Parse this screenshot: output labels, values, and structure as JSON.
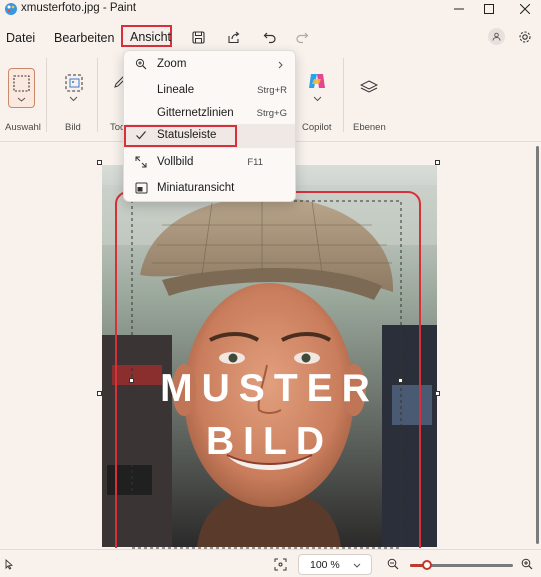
{
  "window": {
    "title": "xmusterfoto.jpg - Paint"
  },
  "menubar": {
    "datei": "Datei",
    "bearbeiten": "Bearbeiten",
    "ansicht": "Ansicht"
  },
  "ribbon": {
    "groups": {
      "auswahl": "Auswahl",
      "bild": "Bild",
      "tools": "Too",
      "copilot": "Copilot",
      "ebenen": "Ebenen"
    }
  },
  "view_menu": {
    "zoom": "Zoom",
    "lineale": "Lineale",
    "lineale_shortcut": "Strg+R",
    "gitternetzlinien": "Gitternetzlinien",
    "gitternetzlinien_shortcut": "Strg+G",
    "statusleiste": "Statusleiste",
    "vollbild": "Vollbild",
    "vollbild_shortcut": "F11",
    "miniaturansicht": "Miniaturansicht"
  },
  "canvas": {
    "watermark_line1": "MUSTER",
    "watermark_line2": "BILD"
  },
  "statusbar": {
    "zoom_value": "100 %"
  },
  "colors": {
    "accent": "#c0392b",
    "highlight": "#d8303a",
    "background": "#f8f1ec"
  }
}
